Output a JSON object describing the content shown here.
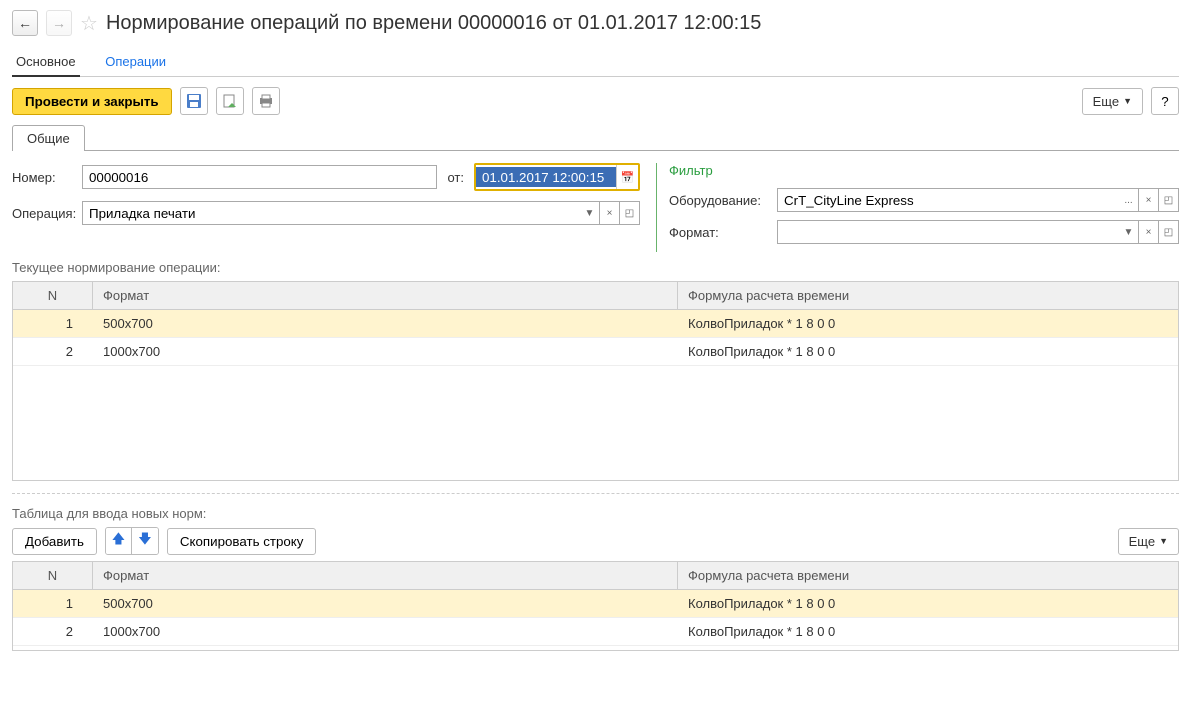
{
  "header": {
    "title": "Нормирование операций по времени 00000016 от 01.01.2017 12:00:15"
  },
  "main_tabs": {
    "main": "Основное",
    "ops": "Операции"
  },
  "toolbar": {
    "post_close": "Провести и закрыть",
    "more": "Еще",
    "help": "?"
  },
  "sub_tab": "Общие",
  "fields": {
    "number_label": "Номер:",
    "number_value": "00000016",
    "from_label": "от:",
    "date_value": "01.01.2017 12:00:15",
    "operation_label": "Операция:",
    "operation_value": "Приладка печати"
  },
  "filter": {
    "title": "Фильтр",
    "equipment_label": "Оборудование:",
    "equipment_value": "CrT_CityLine Express",
    "format_label": "Формат:",
    "format_value": ""
  },
  "current_section_label": "Текущее нормирование операции:",
  "grid_headers": {
    "n": "N",
    "format": "Формат",
    "formula": "Формула расчета времени"
  },
  "current_rows": [
    {
      "n": "1",
      "format": "500х700",
      "formula": "КолвоПриладок * 1 8 0 0"
    },
    {
      "n": "2",
      "format": "1000х700",
      "formula": "КолвоПриладок * 1 8 0 0"
    }
  ],
  "input_section_label": "Таблица для ввода новых норм:",
  "input_toolbar": {
    "add": "Добавить",
    "copy": "Скопировать строку",
    "more": "Еще"
  },
  "input_rows": [
    {
      "n": "1",
      "format": "500х700",
      "formula": "КолвоПриладок * 1 8 0 0"
    },
    {
      "n": "2",
      "format": "1000х700",
      "formula": "КолвоПриладок * 1 8 0 0"
    }
  ]
}
